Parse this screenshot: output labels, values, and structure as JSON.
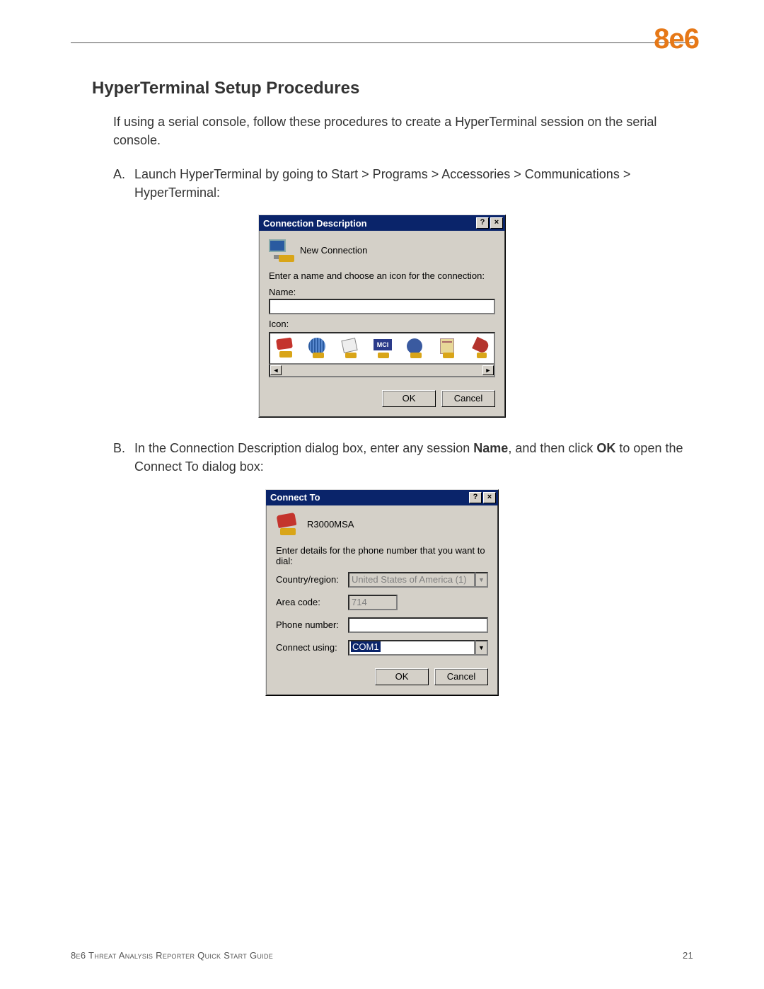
{
  "logo": "8e6",
  "section_title": "HyperTerminal Setup Procedures",
  "intro": "If using a serial console, follow these procedures to create a HyperTerminal session on the serial console.",
  "stepA": {
    "marker": "A.",
    "text": "Launch HyperTerminal by going to Start > Programs > Accessories > Communications > HyperTerminal:"
  },
  "stepB": {
    "marker": "B.",
    "prefix": "In the Connection Description dialog box, enter any session ",
    "bold1": "Name",
    "mid": ", and then click ",
    "bold2": "OK",
    "suffix": " to open the Connect To dialog box:"
  },
  "dialog1": {
    "title": "Connection Description",
    "help_btn": "?",
    "close_btn": "×",
    "heading": "New Connection",
    "prompt": "Enter a name and choose an icon for the connection:",
    "name_label": "Name:",
    "name_value": "",
    "icon_label": "Icon:",
    "icon4_text": "MCI",
    "scroll_left": "◄",
    "scroll_right": "►",
    "ok": "OK",
    "cancel": "Cancel"
  },
  "dialog2": {
    "title": "Connect To",
    "help_btn": "?",
    "close_btn": "×",
    "heading": "R3000MSA",
    "prompt": "Enter details for the phone number that you want to dial:",
    "country_label": "Country/region:",
    "country_value": "United States of America (1)",
    "area_label": "Area code:",
    "area_value": "714",
    "phone_label": "Phone number:",
    "phone_value": "",
    "connect_label": "Connect using:",
    "connect_value": "COM1",
    "combo_arrow": "▼",
    "ok": "OK",
    "cancel": "Cancel"
  },
  "footer": {
    "left": "8e6 Threat Analysis Reporter Quick Start Guide",
    "right": "21"
  }
}
